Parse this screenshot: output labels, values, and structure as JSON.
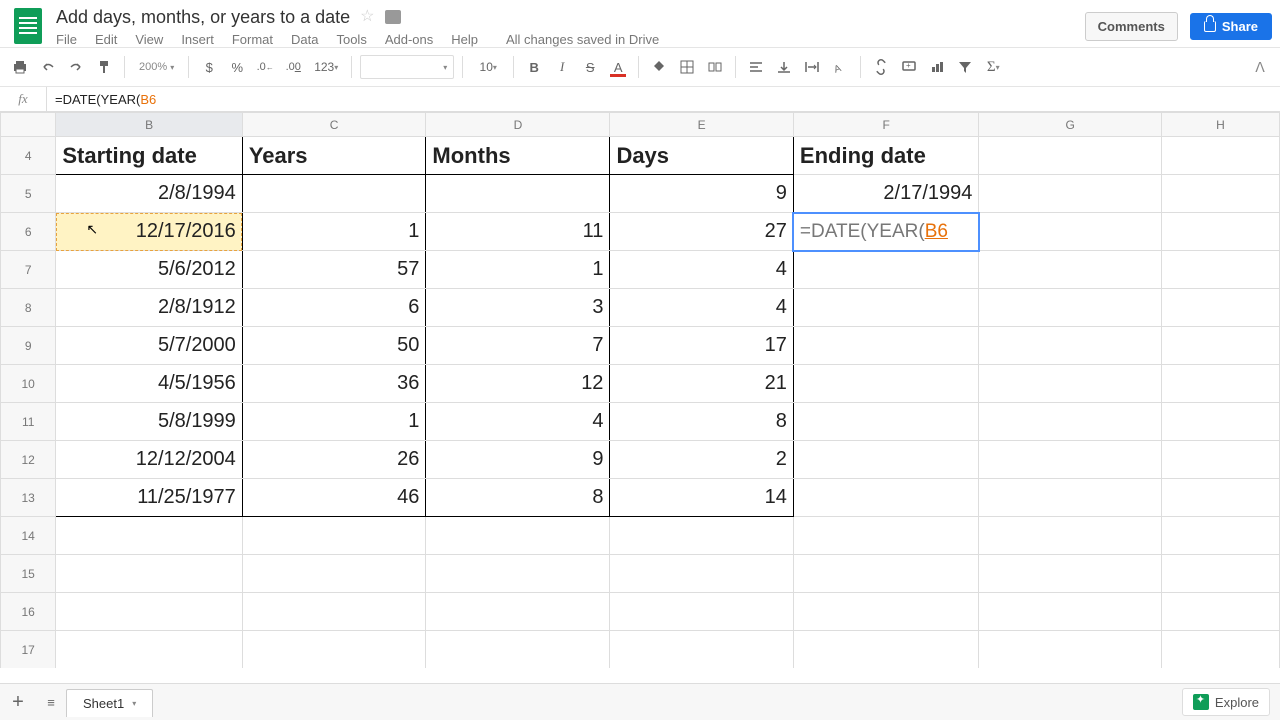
{
  "doc": {
    "title": "Add days, months, or years to a date"
  },
  "menu": {
    "file": "File",
    "edit": "Edit",
    "view": "View",
    "insert": "Insert",
    "format": "Format",
    "data": "Data",
    "tools": "Tools",
    "addons": "Add-ons",
    "help": "Help",
    "status": "All changes saved in Drive"
  },
  "buttons": {
    "comments": "Comments",
    "share": "Share",
    "explore": "Explore"
  },
  "toolbar": {
    "zoom": "200%",
    "currency": "$",
    "percent": "%",
    "dec_dec": ".0",
    "dec_inc": ".00",
    "numfmt": "123",
    "fontsize": "10"
  },
  "fx": {
    "prefix": "=DATE(YEAR(",
    "ref": "B6"
  },
  "formula_cell": {
    "prefix": "=DATE(YEAR(",
    "ref": "B6"
  },
  "cols": [
    "B",
    "C",
    "D",
    "E",
    "F",
    "G",
    "H"
  ],
  "row_nums": [
    "4",
    "5",
    "6",
    "7",
    "8",
    "9",
    "10",
    "11",
    "12",
    "13",
    "14",
    "15",
    "16",
    "17"
  ],
  "head": {
    "b": "Starting date",
    "c": "Years",
    "d": "Months",
    "e": "Days",
    "f": "Ending date"
  },
  "rows": [
    {
      "b": "2/8/1994",
      "c": "",
      "d": "",
      "e": "9",
      "f": "2/17/1994"
    },
    {
      "b": "12/17/2016",
      "c": "1",
      "d": "11",
      "e": "27",
      "f": ""
    },
    {
      "b": "5/6/2012",
      "c": "57",
      "d": "1",
      "e": "4",
      "f": ""
    },
    {
      "b": "2/8/1912",
      "c": "6",
      "d": "3",
      "e": "4",
      "f": ""
    },
    {
      "b": "5/7/2000",
      "c": "50",
      "d": "7",
      "e": "17",
      "f": ""
    },
    {
      "b": "4/5/1956",
      "c": "36",
      "d": "12",
      "e": "21",
      "f": ""
    },
    {
      "b": "5/8/1999",
      "c": "1",
      "d": "4",
      "e": "8",
      "f": ""
    },
    {
      "b": "12/12/2004",
      "c": "26",
      "d": "9",
      "e": "2",
      "f": ""
    },
    {
      "b": "11/25/1977",
      "c": "46",
      "d": "8",
      "e": "14",
      "f": ""
    }
  ],
  "sheet_tab": "Sheet1",
  "fx_label": "fx"
}
